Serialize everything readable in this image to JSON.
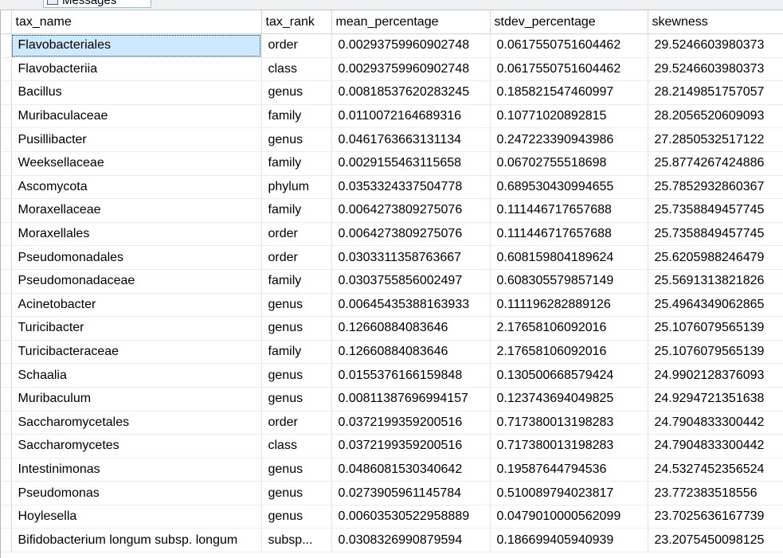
{
  "tabs": {
    "messages_label": "Messages"
  },
  "grid": {
    "columns": [
      "tax_name",
      "tax_rank",
      "mean_percentage",
      "stdev_percentage",
      "skewness"
    ],
    "rows": [
      [
        "Flavobacteriales",
        "order",
        "0.00293759960902748",
        "0.0617550751604462",
        "29.5246603980373"
      ],
      [
        "Flavobacteriia",
        "class",
        "0.00293759960902748",
        "0.0617550751604462",
        "29.5246603980373"
      ],
      [
        "Bacillus",
        "genus",
        "0.00818537620283245",
        "0.185821547460997",
        "28.2149851757057"
      ],
      [
        "Muribaculaceae",
        "family",
        "0.0110072164689316",
        "0.10771020892815",
        "28.2056520609093"
      ],
      [
        "Pusillibacter",
        "genus",
        "0.0461763663131134",
        "0.247223390943986",
        "27.2850532517122"
      ],
      [
        "Weeksellaceae",
        "family",
        "0.0029155463115658",
        "0.06702755518698",
        "25.8774267424886"
      ],
      [
        "Ascomycota",
        "phylum",
        "0.0353324337504778",
        "0.689530430994655",
        "25.7852932860367"
      ],
      [
        "Moraxellaceae",
        "family",
        "0.0064273809275076",
        "0.111446717657688",
        "25.7358849457745"
      ],
      [
        "Moraxellales",
        "order",
        "0.0064273809275076",
        "0.111446717657688",
        "25.7358849457745"
      ],
      [
        "Pseudomonadales",
        "order",
        "0.0303311358763667",
        "0.608159804189624",
        "25.6205988246479"
      ],
      [
        "Pseudomonadaceae",
        "family",
        "0.0303755856002497",
        "0.608305579857149",
        "25.5691313821826"
      ],
      [
        "Acinetobacter",
        "genus",
        "0.00645435388163933",
        "0.111196282889126",
        "25.4964349062865"
      ],
      [
        "Turicibacter",
        "genus",
        "0.12660884083646",
        "2.17658106092016",
        "25.1076079565139"
      ],
      [
        "Turicibacteraceae",
        "family",
        "0.12660884083646",
        "2.17658106092016",
        "25.1076079565139"
      ],
      [
        "Schaalia",
        "genus",
        "0.0155376166159848",
        "0.130500668579424",
        "24.9902128376093"
      ],
      [
        "Muribaculum",
        "genus",
        "0.00811387696994157",
        "0.123743694049825",
        "24.9294721351638"
      ],
      [
        "Saccharomycetales",
        "order",
        "0.0372199359200516",
        "0.717380013198283",
        "24.7904833300442"
      ],
      [
        "Saccharomycetes",
        "class",
        "0.0372199359200516",
        "0.717380013198283",
        "24.7904833300442"
      ],
      [
        "Intestinimonas",
        "genus",
        "0.0486081530340642",
        "0.19587644794536",
        "24.5327452356524"
      ],
      [
        "Pseudomonas",
        "genus",
        "0.0273905961145784",
        "0.510089794023817",
        "23.772383518556"
      ],
      [
        "Hoylesella",
        "genus",
        "0.00603530522958889",
        "0.0479010000562099",
        "23.7025636167739"
      ],
      [
        "Bifidobacterium longum subsp. longum",
        "subsp...",
        "0.0308326990879594",
        "0.186699405940939",
        "23.2075450098125"
      ]
    ],
    "selected_row": 0,
    "selected_col": 0
  },
  "colors": {
    "selection": "#cde8ff",
    "grid_line": "#e2e2e2"
  }
}
